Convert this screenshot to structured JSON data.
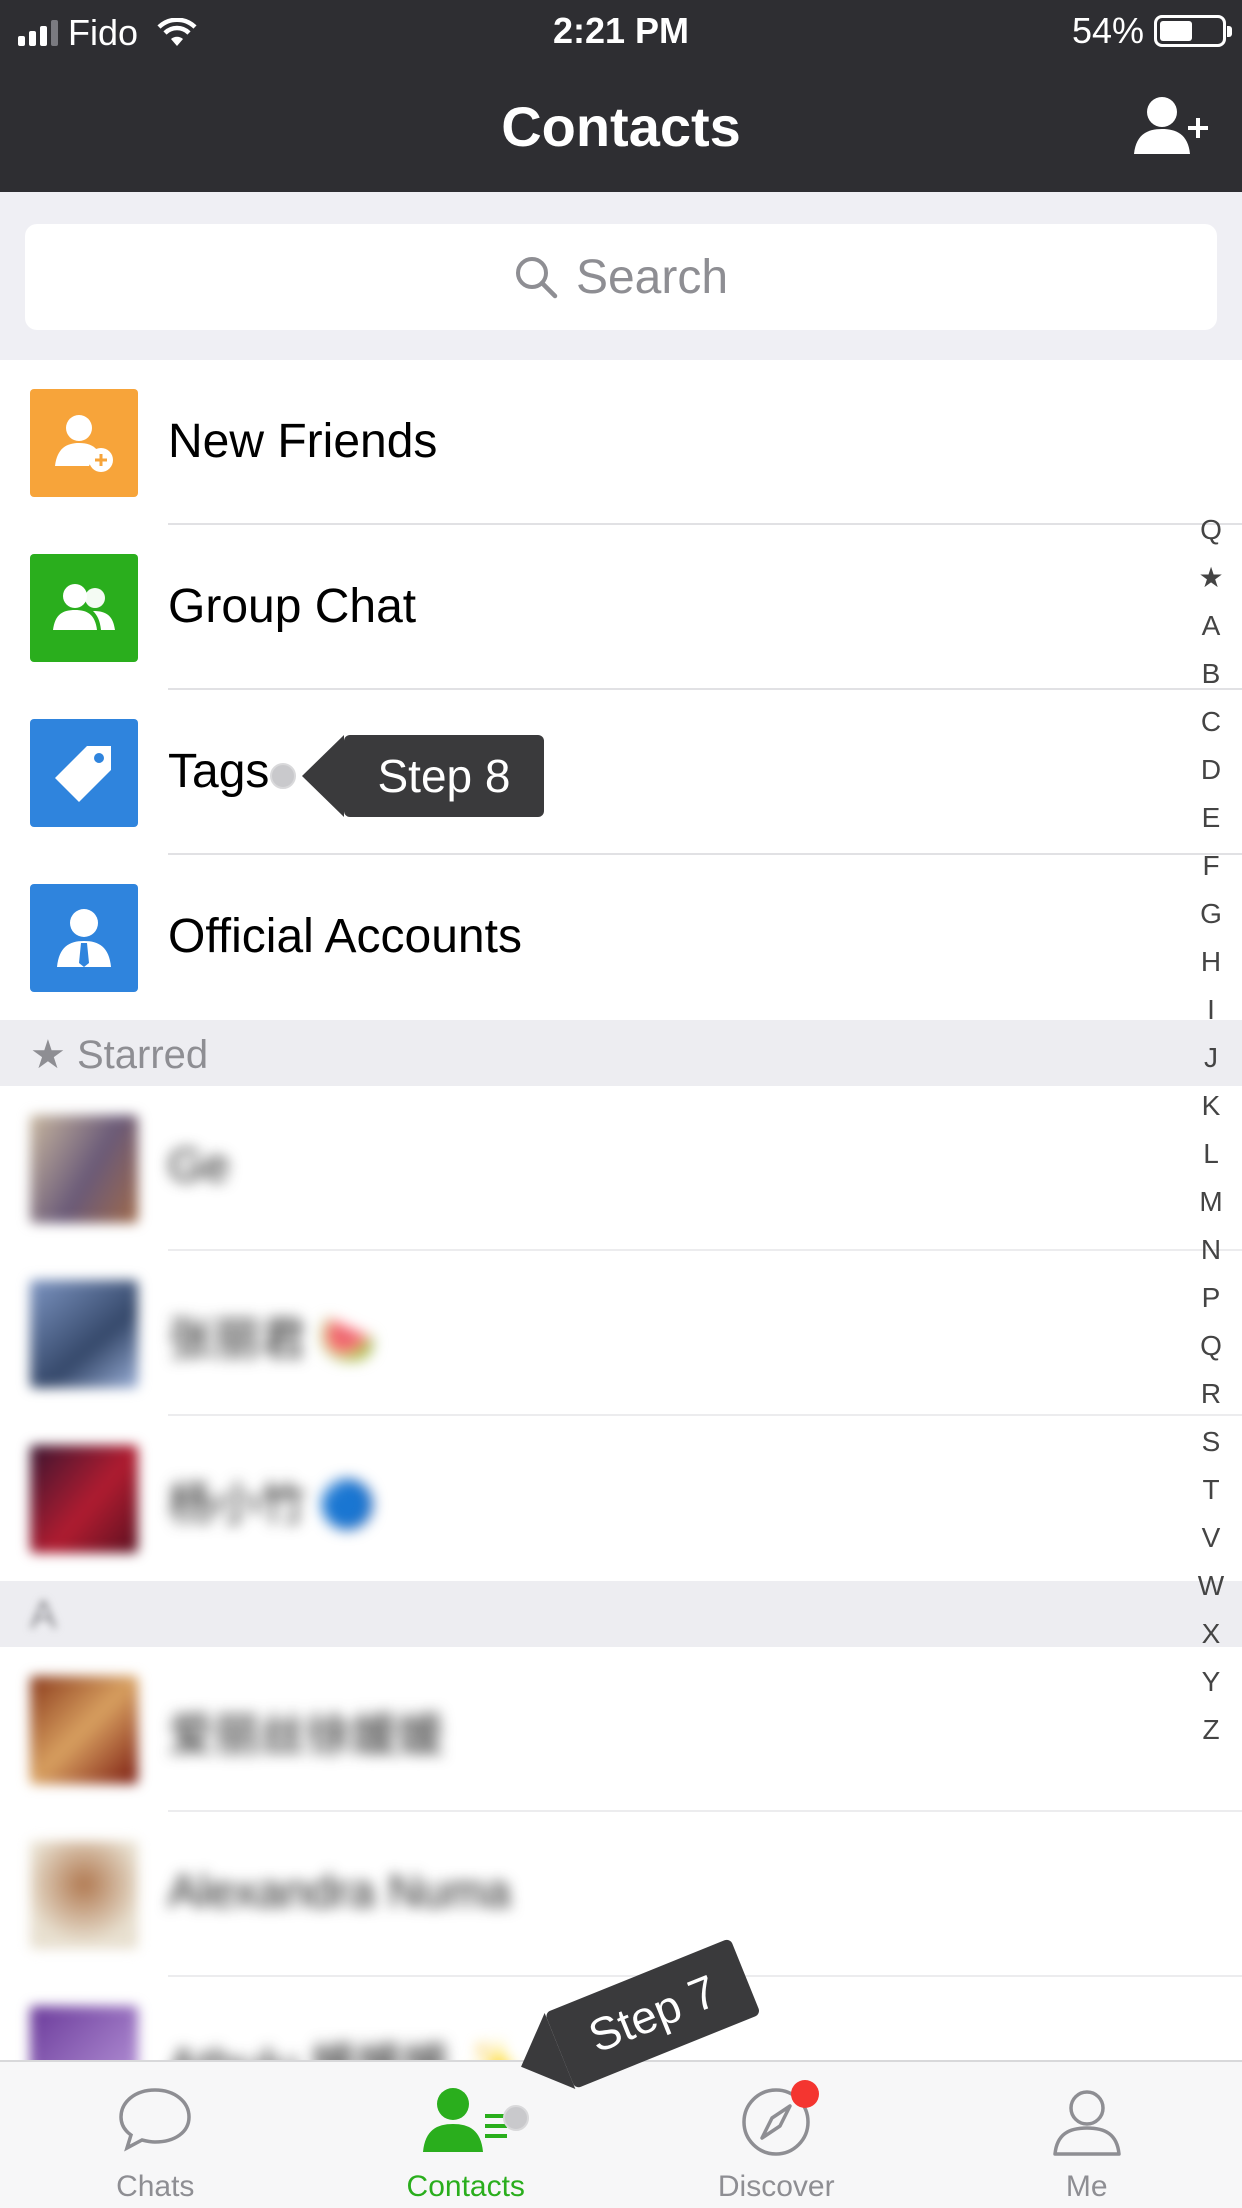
{
  "status_bar": {
    "carrier": "Fido",
    "time": "2:21 PM",
    "battery": "54%",
    "battery_level": 0.54
  },
  "header": {
    "title": "Contacts",
    "add_icon": "add-contact-icon"
  },
  "search": {
    "placeholder": "Search"
  },
  "functions": [
    {
      "label": "New Friends",
      "icon": "new-friends-icon",
      "color": "#f7a43a"
    },
    {
      "label": "Group Chat",
      "icon": "group-chat-icon",
      "color": "#2aae1d"
    },
    {
      "label": "Tags",
      "icon": "tag-icon",
      "color": "#2f84dd"
    },
    {
      "label": "Official Accounts",
      "icon": "official-accounts-icon",
      "color": "#2f84dd"
    }
  ],
  "sections": {
    "starred": "★ Starred",
    "a": "A"
  },
  "starred_contacts": [
    {
      "name": "Ge"
    },
    {
      "name": "张丽君 🍉"
    },
    {
      "name": "杨小竹 🔵"
    }
  ],
  "a_contacts": [
    {
      "name": "爱丽丝徐媛媛"
    },
    {
      "name": "Alexandra Numa"
    },
    {
      "name": "Athulu 媛媛媛 ✨"
    }
  ],
  "index": [
    "Q",
    "★",
    "A",
    "B",
    "C",
    "D",
    "E",
    "F",
    "G",
    "H",
    "I",
    "J",
    "K",
    "L",
    "M",
    "N",
    "P",
    "Q",
    "R",
    "S",
    "T",
    "V",
    "W",
    "X",
    "Y",
    "Z"
  ],
  "tooltips": {
    "step8": "Step 8",
    "step7": "Step 7"
  },
  "tabs": [
    {
      "label": "Chats",
      "icon": "chat-bubble-icon"
    },
    {
      "label": "Contacts",
      "icon": "contacts-icon",
      "active": true
    },
    {
      "label": "Discover",
      "icon": "compass-icon",
      "badge": true
    },
    {
      "label": "Me",
      "icon": "person-icon"
    }
  ],
  "colors": {
    "accent": "#2aae1d",
    "nav_bg": "#2e2e32",
    "badge": "#f43530"
  }
}
